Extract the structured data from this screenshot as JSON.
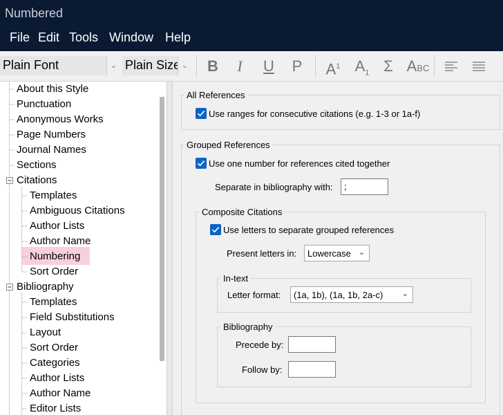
{
  "window": {
    "title": "Numbered"
  },
  "menu": [
    "File",
    "Edit",
    "Tools",
    "Window",
    "Help"
  ],
  "toolbar": {
    "font": "Plain Font",
    "size": "Plain Size",
    "bold": "B",
    "italic": "I",
    "underline": "U",
    "plain": "P",
    "superscript": "A",
    "superscript_mark": "1",
    "subscript": "A",
    "subscript_mark": "1",
    "symbol": "Σ",
    "smallcaps_a": "A",
    "smallcaps_bc": "BC"
  },
  "tree": {
    "items": [
      "About this Style",
      "Punctuation",
      "Anonymous Works",
      "Page Numbers",
      "Journal Names",
      "Sections",
      "Citations",
      "Templates",
      "Ambiguous Citations",
      "Author Lists",
      "Author Name",
      "Numbering",
      "Sort Order",
      "Bibliography",
      "Templates",
      "Field Substitutions",
      "Layout",
      "Sort Order",
      "Categories",
      "Author Lists",
      "Author Name",
      "Editor Lists"
    ],
    "selected": "Numbering"
  },
  "all_references": {
    "title": "All References",
    "use_ranges_label": "Use ranges for consecutive citations (e.g. 1-3 or 1a-f)",
    "use_ranges_checked": true
  },
  "grouped_references": {
    "title": "Grouped References",
    "one_number_label": "Use one number for references cited together",
    "one_number_checked": true,
    "separate_label": "Separate in bibliography with:",
    "separate_value": ";",
    "composite": {
      "title": "Composite Citations",
      "use_letters_label": "Use letters to separate grouped references",
      "use_letters_checked": true,
      "present_label": "Present letters in:",
      "present_value": "Lowercase",
      "intext": {
        "title": "In-text",
        "format_label": "Letter format:",
        "format_value": "(1a, 1b), (1a, 1b, 2a-c)"
      },
      "bibliography": {
        "title": "Bibliography",
        "precede_label": "Precede by:",
        "precede_value": "",
        "follow_label": "Follow by:",
        "follow_value": ""
      }
    }
  },
  "colors": {
    "title_bg": "#0a1a33",
    "checkbox": "#0b64c6",
    "selection": "#f8cfe0"
  }
}
